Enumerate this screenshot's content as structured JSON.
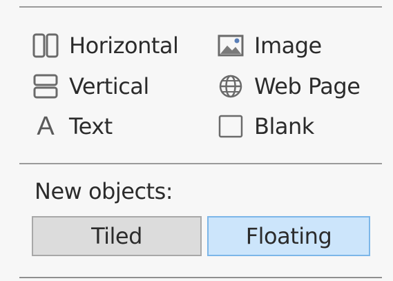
{
  "objects": {
    "horizontal": {
      "label": "Horizontal",
      "icon": "horizontal-container-icon"
    },
    "vertical": {
      "label": "Vertical",
      "icon": "vertical-container-icon"
    },
    "text": {
      "label": "Text",
      "icon": "text-icon",
      "glyph": "A"
    },
    "image": {
      "label": "Image",
      "icon": "image-icon"
    },
    "webpage": {
      "label": "Web Page",
      "icon": "globe-icon"
    },
    "blank": {
      "label": "Blank",
      "icon": "blank-icon"
    }
  },
  "new_objects": {
    "label": "New objects:",
    "tiled": {
      "label": "Tiled",
      "selected": false
    },
    "floating": {
      "label": "Floating",
      "selected": true
    }
  },
  "colors": {
    "icon": "#6a6a6a",
    "floating_selected_bg": "#cce5fb",
    "floating_selected_border": "#7cb6e8",
    "tiled_bg": "#dcdcdc"
  }
}
